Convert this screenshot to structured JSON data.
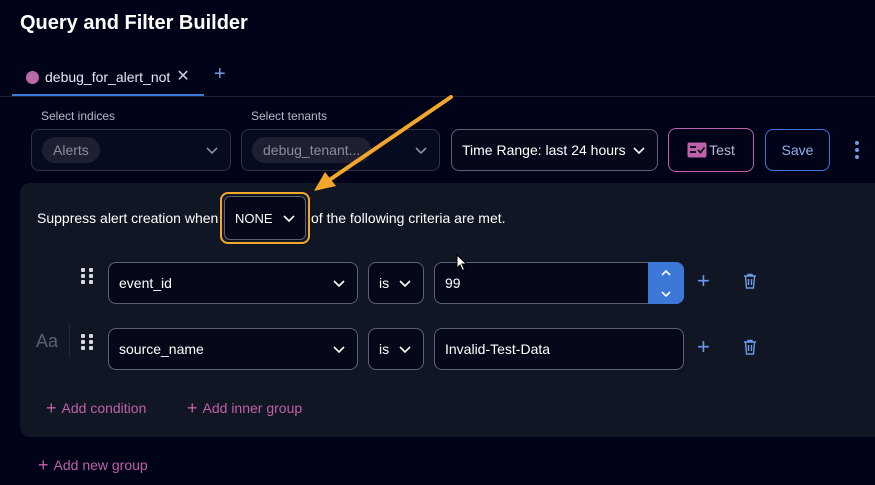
{
  "app": {
    "title": "Query and Filter Builder"
  },
  "tabs": [
    {
      "label": "debug_for_alert_not"
    }
  ],
  "filters": {
    "indices_label": "Select indices",
    "indices_chip": "Alerts",
    "tenants_label": "Select tenants",
    "tenants_chip": "debug_tenant...",
    "time_range": "Time Range: last 24 hours",
    "test_label": "Test",
    "save_label": "Save"
  },
  "suppress": {
    "prefix": "Suppress alert creation when",
    "mode": "NONE",
    "suffix": "of the following criteria are met."
  },
  "conditions": [
    {
      "field": "event_id",
      "operator": "is",
      "value": "99"
    },
    {
      "field": "source_name",
      "operator": "is",
      "value": "Invalid-Test-Data"
    }
  ],
  "case_toggle": "Aa",
  "actions": {
    "add_condition": "Add condition",
    "add_inner_group": "Add inner group",
    "add_new_group": "Add new group"
  },
  "colors": {
    "background": "#010418",
    "panel": "#111624",
    "accent_blue": "#3c78d8",
    "accent_pink": "#c060a8",
    "highlight_orange": "#f3a72a"
  },
  "icons": [
    "close-icon",
    "plus-icon",
    "chevron-down-icon",
    "checklist-icon",
    "kebab-icon",
    "drag-handle-icon",
    "chevron-up-icon",
    "trash-icon",
    "arrow-annotation",
    "mouse-cursor-icon"
  ]
}
